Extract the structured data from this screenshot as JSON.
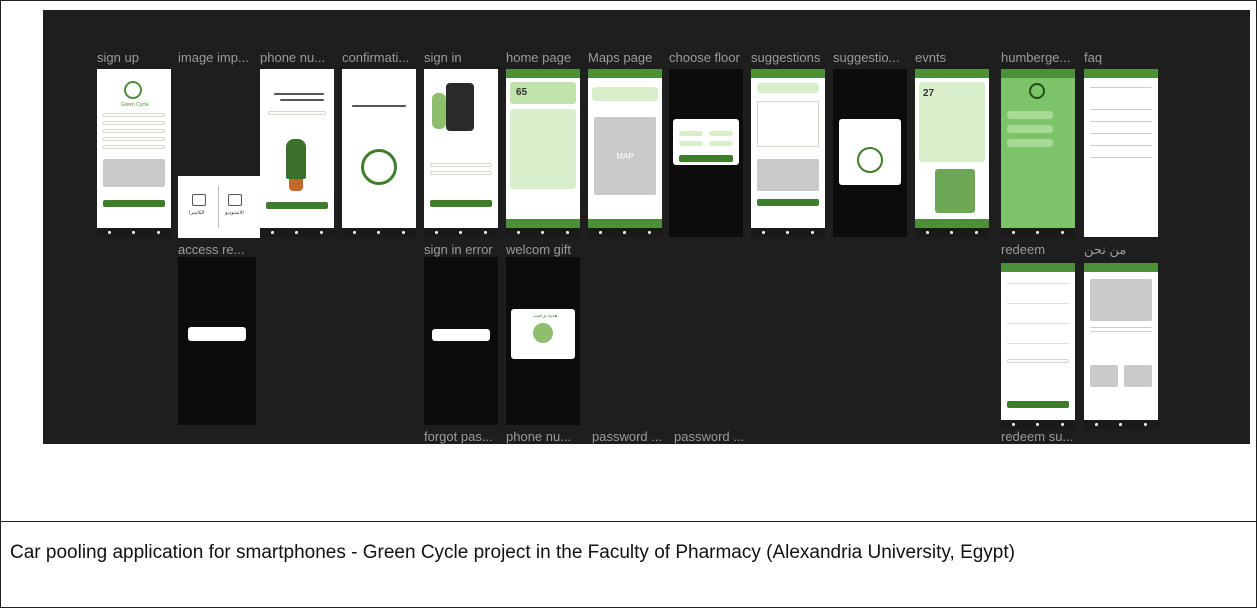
{
  "frames": {
    "sign_up": "sign up",
    "image_imp": "image imp...",
    "phone_nu": "phone nu...",
    "confirmati": "confirmati...",
    "sign_in": "sign in",
    "home_page": "home page",
    "maps_page": "Maps page",
    "choose_floor": "choose floor",
    "suggestions": "suggestions",
    "suggestio": "suggestio...",
    "evnts": "evnts",
    "humberge": "humberge...",
    "faq": "faq",
    "access_re": "access re...",
    "sign_in_error": "sign in error",
    "welcom_gift": "welcom gift",
    "redeem": "redeem",
    "about_us": "من نحن",
    "forgot_pas": "forgot pas...",
    "phone_nu2": "phone nu...",
    "password1": "password ...",
    "password2": "password ...",
    "redeem_su": "redeem su..."
  },
  "screens": {
    "brand": "Green Cycle",
    "home_number": "65",
    "events_number": "27",
    "map_label": "MAP",
    "camera_label": "الكاميرا",
    "gallery_label": "الاستوديو",
    "welcome_gift_title": "هدية ترحيب"
  },
  "caption": "Car pooling application for smartphones - Green Cycle project in the Faculty of Pharmacy (Alexandria University, Egypt)",
  "colors": {
    "canvas": "#1e1e1e",
    "accent_green": "#4e8f3a",
    "light_green": "#bfe3aa"
  }
}
